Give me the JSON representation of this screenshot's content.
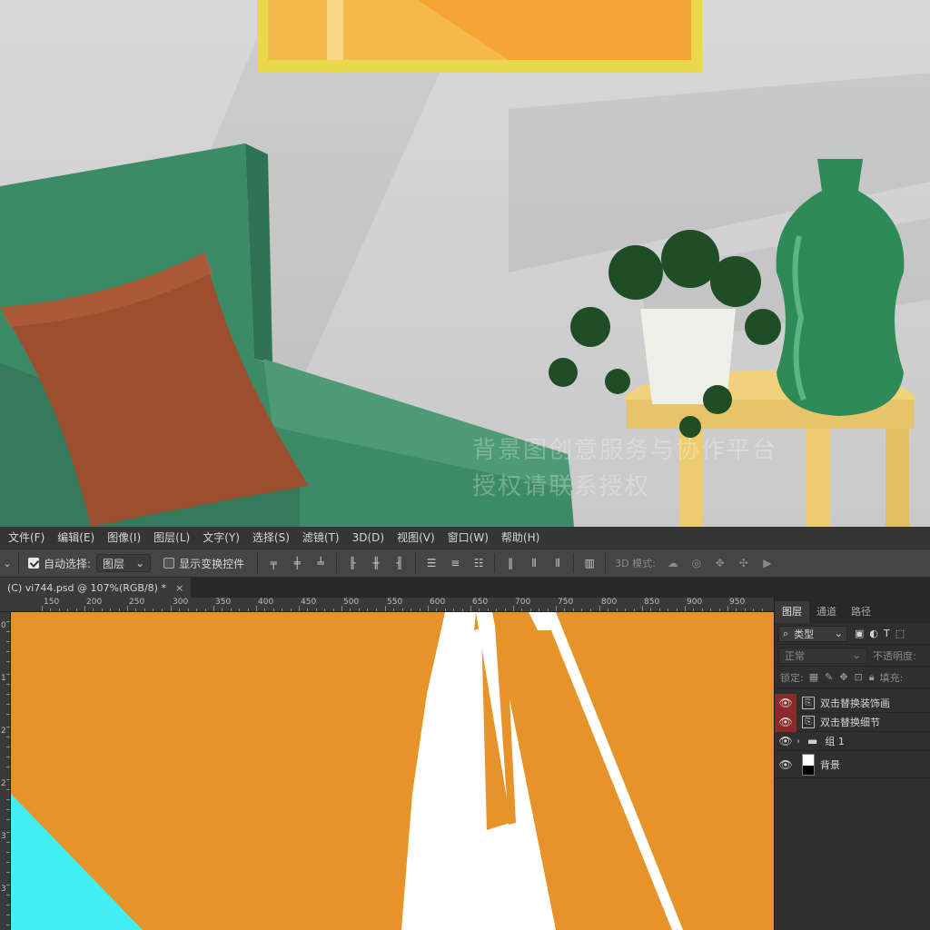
{
  "preview": {
    "watermark_line1": "背景图创意服务与协作平台",
    "watermark_line2": "授权请联系授权"
  },
  "menubar": {
    "items": [
      "文件(F)",
      "编辑(E)",
      "图像(I)",
      "图层(L)",
      "文字(Y)",
      "选择(S)",
      "滤镜(T)",
      "3D(D)",
      "视图(V)",
      "窗口(W)",
      "帮助(H)"
    ]
  },
  "options": {
    "auto_select_label": "自动选择:",
    "auto_select_checked": true,
    "target_select": "图层",
    "show_transform_label": "显示变换控件",
    "show_transform_checked": false,
    "mode_3d_label": "3D 模式:"
  },
  "document": {
    "tab_title": "(C) vi744.psd @ 107%(RGB/8) *",
    "close_glyph": "×"
  },
  "ruler": {
    "top_labels": [
      "150",
      "200",
      "250",
      "300",
      "350",
      "400",
      "450",
      "500",
      "550",
      "600",
      "650",
      "700",
      "750",
      "800",
      "850",
      "900",
      "950"
    ],
    "left_labels": [
      "0",
      "1",
      "2",
      "2",
      "3",
      "3"
    ]
  },
  "colors": {
    "canvas_bg": "#e69329",
    "cyan_shape": "#43eef2",
    "sofa": "#3d8a66",
    "pillow": "#9c4e2e",
    "table": "#f1d17b",
    "vase": "#2e8b57",
    "frame": "#e9d84a"
  },
  "layers_panel": {
    "tabs": [
      "图层",
      "通道",
      "路径"
    ],
    "filter_label": "类型",
    "blend_mode": "正常",
    "opacity_label": "不透明度:",
    "lock_label": "锁定:",
    "fill_label": "填充:",
    "layers": [
      {
        "name": "双击替换装饰画",
        "type": "smart",
        "highlight": true
      },
      {
        "name": "双击替换细节",
        "type": "smart",
        "highlight": true
      },
      {
        "name": "组 1",
        "type": "group",
        "highlight": false
      },
      {
        "name": "背景",
        "type": "background",
        "highlight": false
      }
    ]
  }
}
